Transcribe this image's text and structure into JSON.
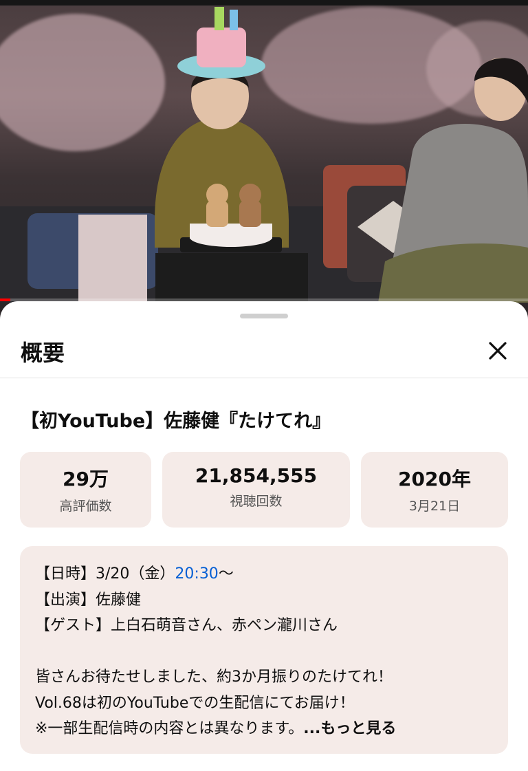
{
  "sheet": {
    "title": "概要",
    "video_title": "【初YouTube】佐藤健『たけてれ』",
    "stats": [
      {
        "value": "29万",
        "label": "高評価数"
      },
      {
        "value": "21,854,555",
        "label": "視聴回数"
      },
      {
        "value": "2020年",
        "label": "3月21日"
      }
    ],
    "description": {
      "line1_prefix": "【日時】3/20（金）",
      "line1_time": "20:30",
      "line1_suffix": "〜",
      "line2": "【出演】佐藤健",
      "line3": "【ゲスト】上白石萌音さん、赤ペン瀧川さん",
      "line4": "皆さんお待たせしました、約3か月振りのたけてれ！",
      "line5": "Vol.68は初のYouTubeでの生配信にてお届け！",
      "line6": "※一部生配信時の内容とは異なります。",
      "more_label": "...もっと見る"
    }
  },
  "video": {
    "progress": 0.02,
    "progress_color": "#ff0000",
    "link_color": "#065fd4",
    "card_color": "#f5ebe8"
  }
}
